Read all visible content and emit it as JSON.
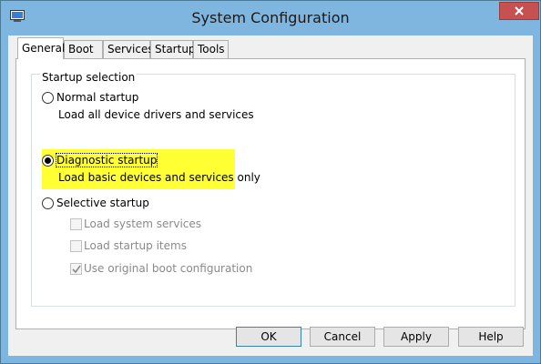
{
  "window": {
    "title": "System Configuration"
  },
  "tabs": [
    {
      "label": "General",
      "active": true
    },
    {
      "label": "Boot",
      "active": false
    },
    {
      "label": "Services",
      "active": false
    },
    {
      "label": "Startup",
      "active": false
    },
    {
      "label": "Tools",
      "active": false
    }
  ],
  "startup_selection": {
    "group_label": "Startup selection",
    "options": [
      {
        "label": "Normal startup",
        "description": "Load all device drivers and services",
        "selected": false
      },
      {
        "label": "Diagnostic startup",
        "description": "Load basic devices and services only",
        "selected": true
      },
      {
        "label": "Selective startup",
        "selected": false
      }
    ],
    "selective_items": [
      {
        "label": "Load system services",
        "checked": false,
        "enabled": false
      },
      {
        "label": "Load startup items",
        "checked": false,
        "enabled": false
      },
      {
        "label": "Use original boot configuration",
        "checked": true,
        "enabled": false
      }
    ]
  },
  "buttons": {
    "ok": "OK",
    "cancel": "Cancel",
    "apply": "Apply",
    "help": "Help"
  },
  "colors": {
    "titlebar": "#7fb6e0",
    "highlight": "#ffff33",
    "close": "#c75050"
  },
  "icons": {
    "app": "system-config-icon",
    "close": "close-icon",
    "check": "checkmark-icon"
  }
}
